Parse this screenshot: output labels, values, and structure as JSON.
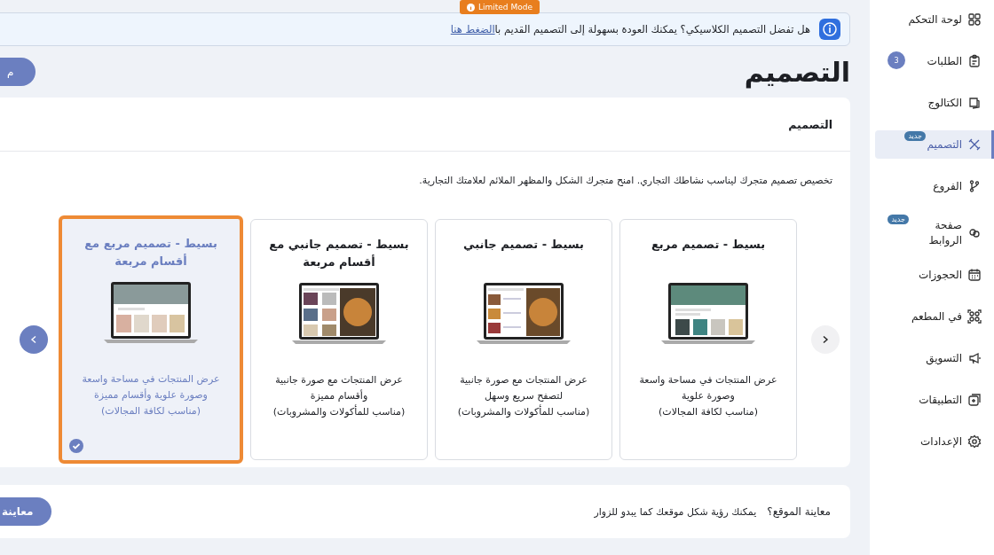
{
  "limited_mode": {
    "label": "Limited Mode"
  },
  "notice": {
    "text": "هل تفضل التصميم الكلاسيكي؟ يمكنك العودة بسهولة إلى التصميم القديم با",
    "link": "الضغط هنا"
  },
  "page_title": "التصميم",
  "header_button": "م",
  "design_panel": {
    "title": "التصميم",
    "description": "تخصيص تصميم متجرك ليناسب نشاطك التجاري. امنح متجرك الشكل والمظهر الملائم لعلامتك التجارية.",
    "cards": [
      {
        "kind": "banner",
        "title": "بسيط - تصميم مربع",
        "description": "عرض المنتجات في مساحة واسعة وصورة علوية",
        "note": "(مناسب لكافة المجالات)",
        "selected": false
      },
      {
        "kind": "side",
        "title": "بسيط - تصميم جانبي",
        "description": "عرض المنتجات مع صورة جانبية لتصفح سريع وسهل",
        "note": "(مناسب للمأكولات والمشروبات)",
        "selected": false
      },
      {
        "kind": "side_grid",
        "title": "بسيط - تصميم جانبي مع أقسام مربعة",
        "description": "عرض المنتجات مع صورة جانبية وأقسام مميزة",
        "note": "(مناسب للمأكولات والمشروبات)",
        "selected": false
      },
      {
        "kind": "banner_grid",
        "title": "بسيط - تصميم مربع مع أقسام مربعة",
        "description": "عرض المنتجات في مساحة واسعة وصورة علوية وأقسام مميزة",
        "note": "(مناسب لكافة المجالات)",
        "selected": true
      }
    ]
  },
  "preview": {
    "question": "معاينة الموقع؟",
    "text": "يمكنك رؤية شكل موقعك كما يبدو للزوار",
    "button": "معاينة"
  },
  "sidebar": {
    "items": [
      {
        "label": "لوحة التحكم",
        "selected": false
      },
      {
        "label": "الطلبات",
        "badge": "3",
        "selected": false
      },
      {
        "label": "الكتالوج",
        "selected": false
      },
      {
        "label": "التصميم",
        "tag": "جديد",
        "selected": true
      },
      {
        "label": "الفروع",
        "selected": false
      },
      {
        "label": "صفحة الروابط",
        "tag": "جديد",
        "selected": false
      },
      {
        "label": "الحجوزات",
        "selected": false
      },
      {
        "label": "في المطعم",
        "selected": false
      },
      {
        "label": "التسويق",
        "selected": false
      },
      {
        "label": "التطبيقات",
        "selected": false
      },
      {
        "label": "الإعدادات",
        "selected": false
      }
    ]
  }
}
